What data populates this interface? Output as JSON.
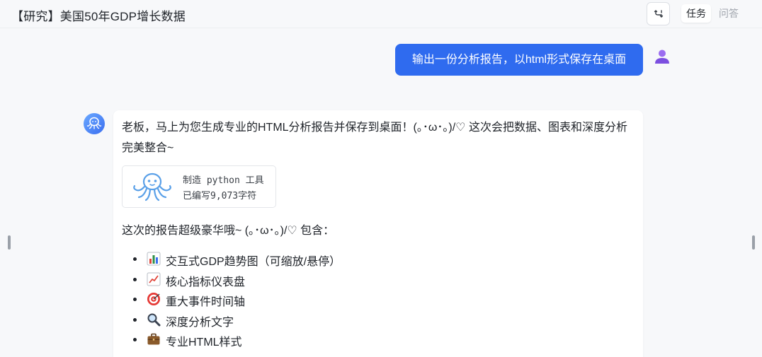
{
  "header": {
    "title": "【研究】美国50年GDP增长数据",
    "tabs": [
      {
        "label": "任务",
        "active": true
      },
      {
        "label": "问答",
        "active": false
      }
    ]
  },
  "chat": {
    "user_message": "输出一份分析报告，以html形式保存在桌面",
    "bot": {
      "intro": "老板，马上为您生成专业的HTML分析报告并保存到桌面！(｡･ω･｡)/♡ 这次会把数据、图表和深度分析完美整合~",
      "tool": {
        "name": "制造 python 工具",
        "status": "已编写9,073字符"
      },
      "includes_label": "这次的报告超级豪华哦~ (｡･ω･｡)/♡ 包含：",
      "features": [
        {
          "icon": "bar-chart-icon",
          "label": "交互式GDP趋势图（可缩放/悬停）"
        },
        {
          "icon": "trend-up-icon",
          "label": "核心指标仪表盘"
        },
        {
          "icon": "target-icon",
          "label": "重大事件时间轴"
        },
        {
          "icon": "magnifier-icon",
          "label": "深度分析文字"
        },
        {
          "icon": "briefcase-icon",
          "label": "专业HTML样式"
        }
      ]
    }
  },
  "colors": {
    "accent": "#2f6bef",
    "background": "#f7f8fa",
    "card": "#ffffff"
  }
}
